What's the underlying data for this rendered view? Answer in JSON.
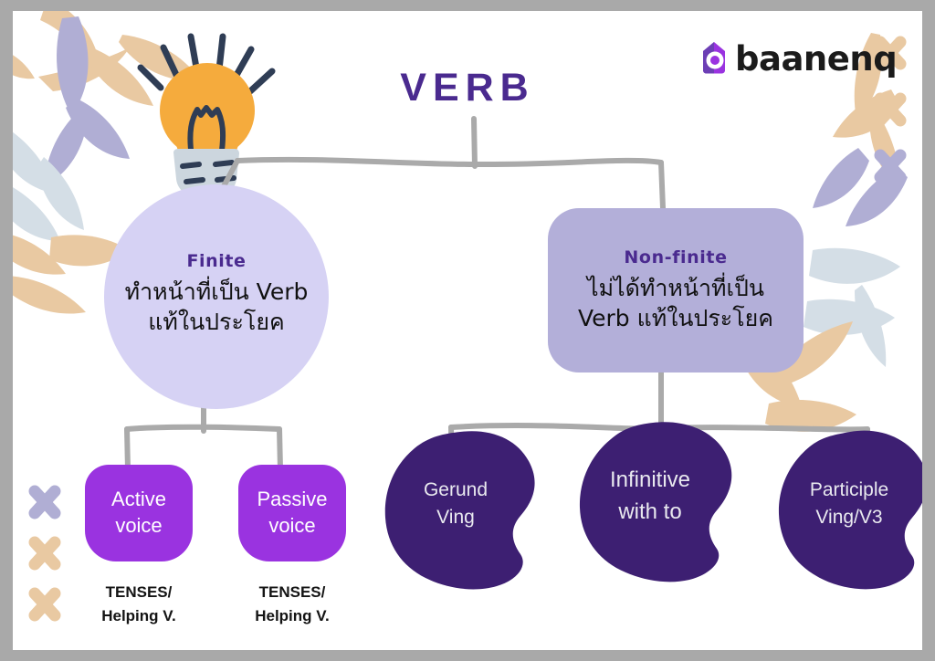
{
  "title": "VERB",
  "brand": {
    "name": "baanenq",
    "mark_icon": "baanenq-house-logo-icon",
    "mark_color": "#9a33e0",
    "mark_color_dark": "#6c3fb5"
  },
  "theme": {
    "frame": "#a9a9a9",
    "page": "#ffffff",
    "deep_purple": "#3d1f72",
    "title_purple": "#4a2a8f",
    "bright_purple": "#9a33e0",
    "lavender_light": "#d6d2f4",
    "lavender_mid": "#b3afd9",
    "connector_gray": "#aaaaaa",
    "leaf_tan": "#e9c9a2",
    "leaf_lavender": "#b0aed4",
    "leaf_blue": "#d4dee6",
    "bulb_amber": "#f5ab3d",
    "bulb_base": "#ccd6de",
    "bulb_line": "#2f3d55"
  },
  "decor": {
    "bulb_icon": "light-bulb-idea-icon",
    "leaf_cluster_icon": "leaf-cluster-icon",
    "cross_icon": "x-cross-icon",
    "crosses_right": [
      {
        "color": "#e9c9a2"
      },
      {
        "color": "#e9c9a2"
      },
      {
        "color": "#b0aed4"
      }
    ],
    "crosses_left": [
      {
        "color": "#b0aed4"
      },
      {
        "color": "#e9c9a2"
      },
      {
        "color": "#e9c9a2"
      }
    ]
  },
  "chart_data": {
    "type": "diagram",
    "diagram_kind": "hierarchy-tree",
    "title": "VERB",
    "root": "VERB",
    "nodes": [
      {
        "id": "finite",
        "label": "Finite",
        "description": "ทำหน้าที่เป็น Verb แท้ในประโยค",
        "shape": "circle",
        "fill": "#d6d2f4",
        "level": 1,
        "parent": "VERB"
      },
      {
        "id": "nonfinite",
        "label": "Non-finite",
        "description": "ไม่ได้ทำหน้าที่เป็น Verb แท้ในประโยค",
        "shape": "rounded-rect",
        "fill": "#b3afd9",
        "level": 1,
        "parent": "VERB"
      },
      {
        "id": "active-voice",
        "label": "Active voice",
        "note": "TENSES/ Helping V.",
        "shape": "rounded-pill",
        "fill": "#9a33e0",
        "level": 2,
        "parent": "finite"
      },
      {
        "id": "passive-voice",
        "label": "Passive voice",
        "note": "TENSES/ Helping V.",
        "shape": "rounded-pill",
        "fill": "#9a33e0",
        "level": 2,
        "parent": "finite"
      },
      {
        "id": "gerund",
        "label": "Gerund Ving",
        "shape": "blob",
        "fill": "#3d1f72",
        "level": 2,
        "parent": "nonfinite"
      },
      {
        "id": "infinitive",
        "label": "Infinitive with to",
        "shape": "blob",
        "fill": "#3d1f72",
        "level": 2,
        "parent": "nonfinite"
      },
      {
        "id": "participle",
        "label": "Participle Ving/V3",
        "shape": "blob",
        "fill": "#3d1f72",
        "level": 2,
        "parent": "nonfinite"
      }
    ]
  },
  "tree": {
    "finite": {
      "heading": "Finite",
      "line1": "ทำหน้าที่เป็น Verb",
      "line2": "แท้ในประโยค"
    },
    "nonfinite": {
      "heading": "Non-finite",
      "line1": "ไม่ได้ทำหน้าที่เป็น",
      "line2": "Verb แท้ในประโยค"
    },
    "active": {
      "line1": "Active",
      "line2": "voice",
      "note1": "TENSES/",
      "note2": "Helping V."
    },
    "passive": {
      "line1": "Passive",
      "line2": "voice",
      "note1": "TENSES/",
      "note2": "Helping V."
    },
    "gerund": {
      "line1": "Gerund",
      "line2": "Ving"
    },
    "infinitive": {
      "line1": "Infinitive",
      "line2": "with to"
    },
    "participle": {
      "line1": "Participle",
      "line2": "Ving/V3"
    }
  }
}
